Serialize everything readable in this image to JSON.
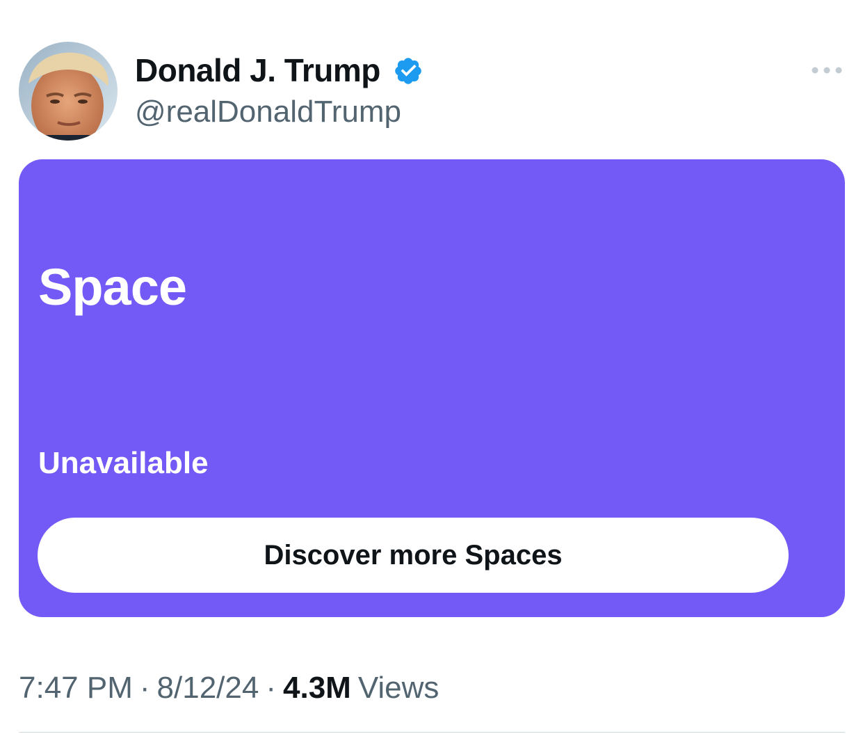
{
  "author": {
    "display_name": "Donald J. Trump",
    "handle": "@realDonaldTrump",
    "verified": true,
    "verified_icon": "verified-badge-icon",
    "avatar": "avatar-photo"
  },
  "more_menu_icon": "more-horizontal-icon",
  "space_card": {
    "title": "Space",
    "status": "Unavailable",
    "button_label": "Discover more Spaces",
    "background_color": "#7359f5"
  },
  "meta": {
    "time": "7:47 PM",
    "separator": "·",
    "date": "8/12/24",
    "views_count": "4.3M",
    "views_label": "Views"
  },
  "colors": {
    "verified": "#1d9bf0",
    "secondary_text": "#536471",
    "primary_text": "#0f1419"
  }
}
